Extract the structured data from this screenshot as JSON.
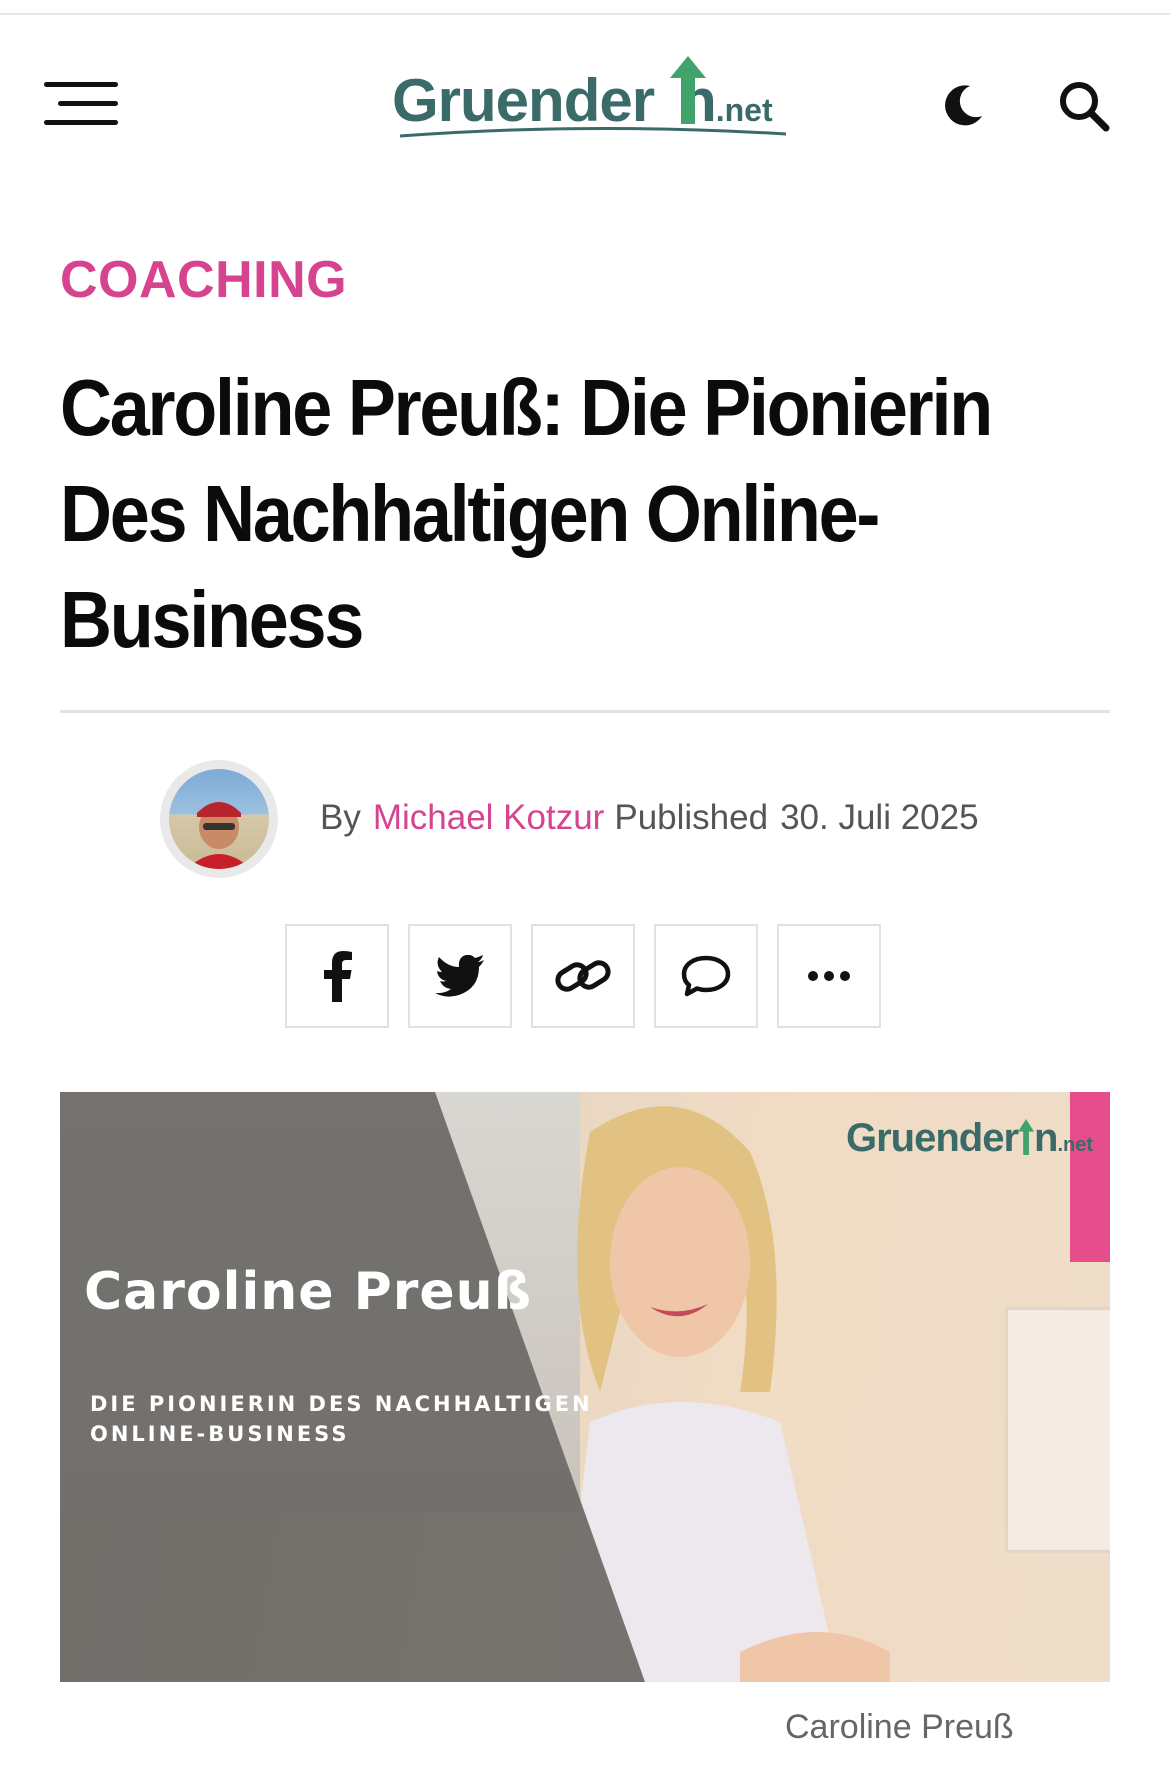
{
  "header": {
    "menu_icon": "hamburger-menu-icon",
    "logo_text": "Gruender",
    "logo_text_end": "n",
    "logo_suffix": ".net",
    "dark_mode_icon": "moon-icon",
    "search_icon": "search-icon"
  },
  "article": {
    "category": "COACHING",
    "title": "Caroline Preuß: Die Pionierin Des Nachhaltigen Online-Business",
    "byline": {
      "by": "By",
      "author": "Michael Kotzur",
      "published": "Published",
      "date": "30. Juli 2025"
    },
    "share_buttons": [
      {
        "icon": "facebook-icon"
      },
      {
        "icon": "twitter-icon"
      },
      {
        "icon": "link-icon"
      },
      {
        "icon": "comment-icon"
      },
      {
        "icon": "more-icon"
      }
    ],
    "hero": {
      "overlay_title": "Caroline Preuß",
      "overlay_subtitle_line1": "DIE PIONIERIN DES NACHHALTIGEN",
      "overlay_subtitle_line2": "ONLINE-BUSINESS",
      "logo_text": "Gruender",
      "logo_text_end": "n",
      "logo_suffix": ".net"
    },
    "caption": "Caroline Preuß"
  },
  "colors": {
    "accent_pink": "#d6438e",
    "logo_teal": "#3a6b68",
    "logo_green": "#3fa36b"
  }
}
